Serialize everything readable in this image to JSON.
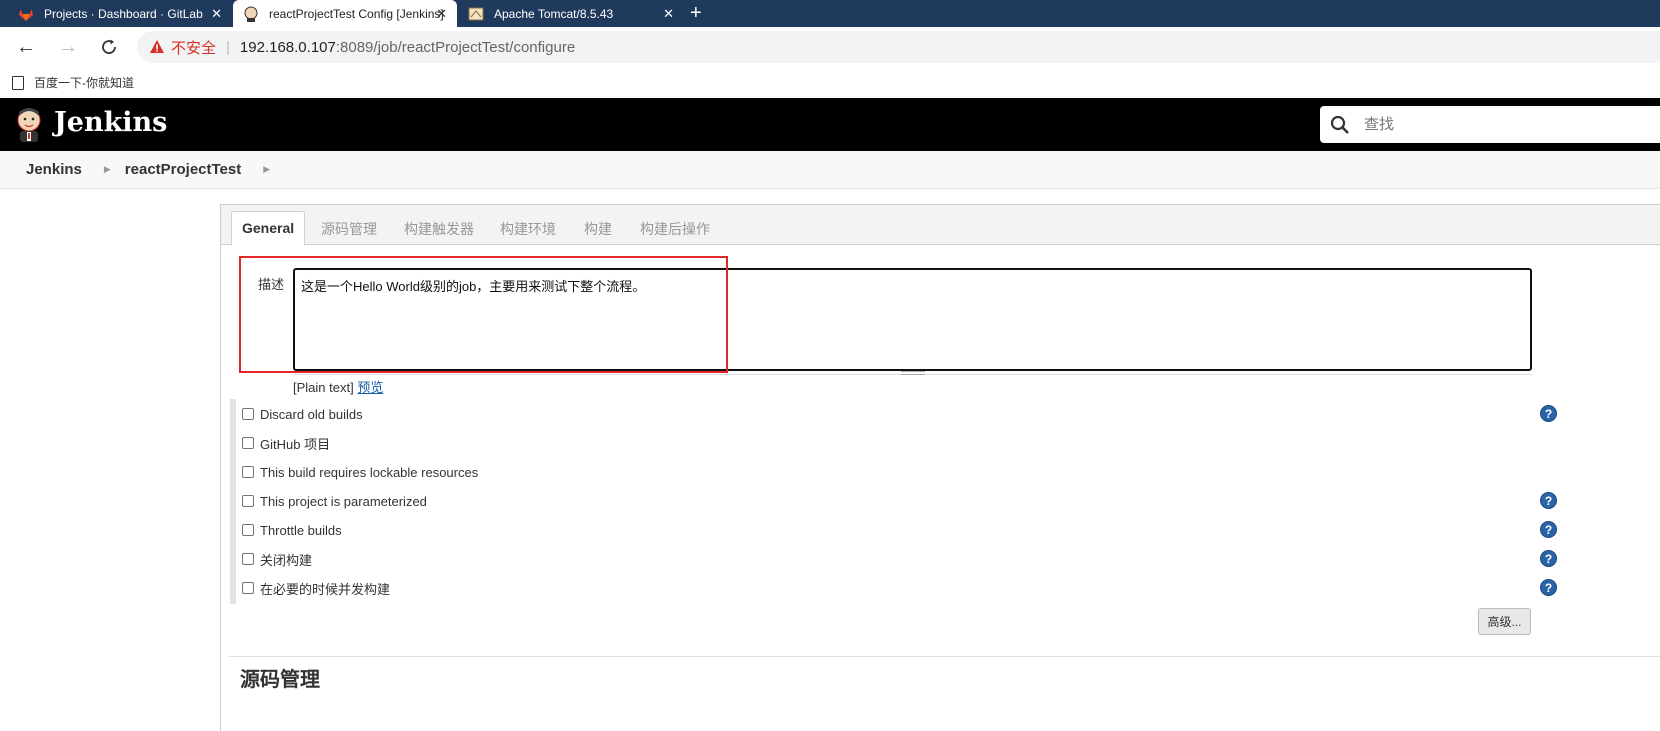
{
  "browser": {
    "tabs": [
      {
        "title": "Projects · Dashboard · GitLab",
        "icon": "gitlab-icon"
      },
      {
        "title": "reactProjectTest Config [Jenkins]",
        "icon": "jenkins-icon"
      },
      {
        "title": "Apache Tomcat/8.5.43",
        "icon": "tomcat-icon"
      }
    ],
    "security_label": "不安全",
    "url_host": "192.168.0.107",
    "url_rest": ":8089/job/reactProjectTest/configure",
    "bookmark": "百度一下-你就知道"
  },
  "header": {
    "title": "Jenkins",
    "search_placeholder": "查找"
  },
  "breadcrumb": [
    "Jenkins",
    "reactProjectTest"
  ],
  "config": {
    "tabs": [
      "General",
      "源码管理",
      "构建触发器",
      "构建环境",
      "构建",
      "构建后操作"
    ],
    "desc_label": "描述",
    "description": "这是一个Hello World级别的job，主要用来测试下整个流程。",
    "plain_text": "[Plain text]",
    "preview_link": "预览",
    "options": [
      {
        "label": "Discard old builds",
        "help": true
      },
      {
        "label": "GitHub 项目",
        "help": false
      },
      {
        "label": "This build requires lockable resources",
        "help": false
      },
      {
        "label": "This project is parameterized",
        "help": true
      },
      {
        "label": "Throttle builds",
        "help": true
      },
      {
        "label": "关闭构建",
        "help": true
      },
      {
        "label": "在必要的时候并发构建",
        "help": true
      }
    ],
    "advanced_button": "高级...",
    "next_section": "源码管理"
  },
  "colors": {
    "browser_tab_bg": "#1f3a5c",
    "jenkins_header_bg": "#000000",
    "highlight_box": "#e0282a",
    "help_icon": "#2a64a8",
    "insecure": "#d93025"
  }
}
